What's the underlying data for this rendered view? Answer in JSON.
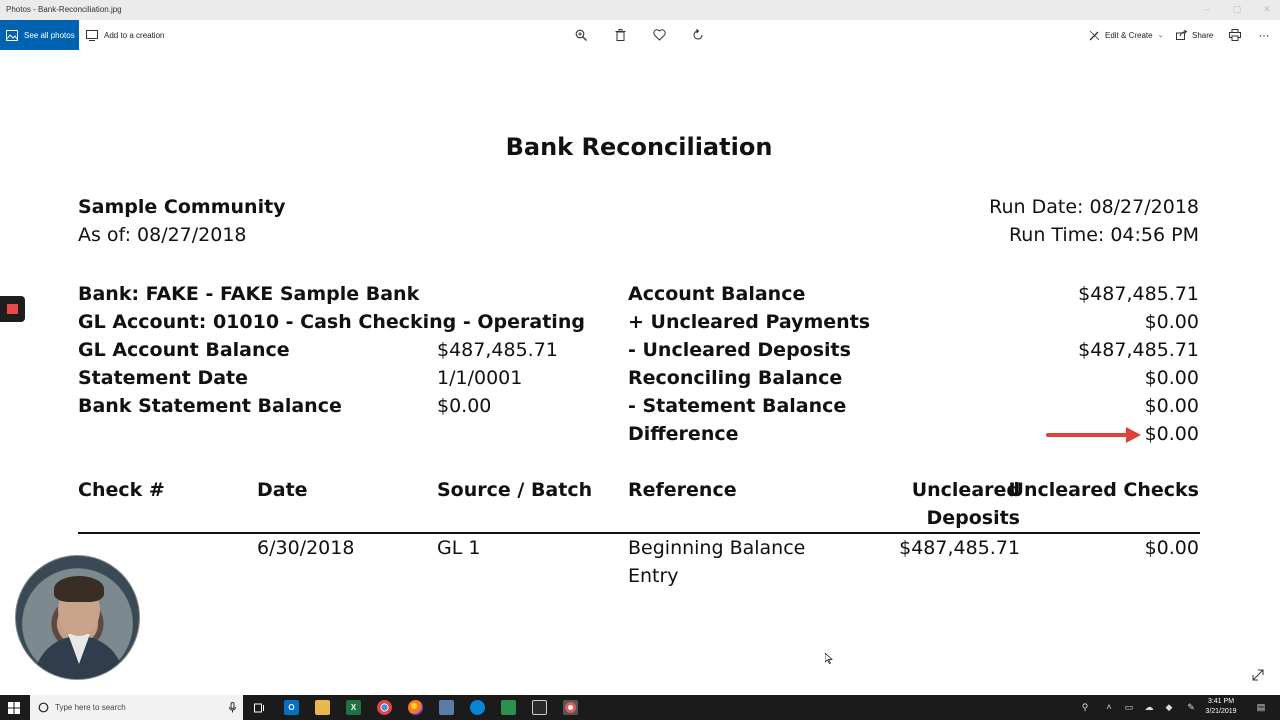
{
  "window": {
    "title": "Photos - Bank-Reconciliation.jpg"
  },
  "toolbar": {
    "see_all_photos": "See all photos",
    "add_to_creation": "Add to a creation",
    "edit_create": "Edit & Create",
    "share": "Share"
  },
  "report": {
    "title": "Bank Reconciliation",
    "community": "Sample Community",
    "as_of": "As of: 08/27/2018",
    "run_date": "Run Date: 08/27/2018",
    "run_time": "Run Time: 04:56 PM",
    "left_block": [
      {
        "label": "Bank: FAKE - FAKE Sample Bank",
        "value": ""
      },
      {
        "label": "GL Account: 01010 - Cash Checking - Operating",
        "value": ""
      },
      {
        "label": "GL Account Balance",
        "value": "$487,485.71"
      },
      {
        "label": "Statement Date",
        "value": "1/1/0001"
      },
      {
        "label": "Bank Statement Balance",
        "value": "$0.00"
      }
    ],
    "right_block": [
      {
        "label": "Account Balance",
        "value": "$487,485.71"
      },
      {
        "label": "+ Uncleared Payments",
        "value": "$0.00"
      },
      {
        "label": "- Uncleared Deposits",
        "value": "$487,485.71"
      },
      {
        "label": "Reconciling Balance",
        "value": "$0.00"
      },
      {
        "label": "- Statement Balance",
        "value": "$0.00"
      },
      {
        "label": "Difference",
        "value": "$0.00"
      }
    ],
    "table_headers": {
      "check": "Check #",
      "date": "Date",
      "source": "Source / Batch",
      "reference": "Reference",
      "uncleared_deposits_1": "Uncleared",
      "uncleared_deposits_2": "Deposits",
      "uncleared_checks": "Uncleared Checks"
    },
    "rows": [
      {
        "check": "",
        "date": "6/30/2018",
        "source": "GL 1",
        "reference_1": "Beginning Balance",
        "reference_2": "Entry",
        "uncleared_deposits": "$487,485.71",
        "uncleared_checks": "$0.00"
      }
    ]
  },
  "taskbar": {
    "search_placeholder": "Type here to search",
    "time": "3:41 PM",
    "date": "3/21/2019"
  },
  "colors": {
    "accent": "#0063b1",
    "arrow": "#e0413a",
    "taskbar": "#1b1b1b"
  }
}
